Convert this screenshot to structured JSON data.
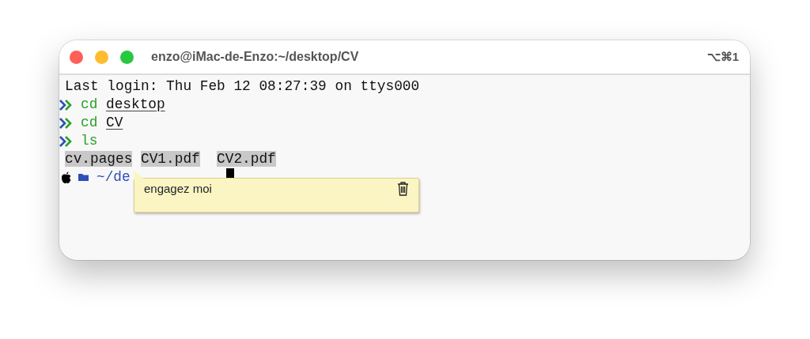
{
  "window": {
    "title": "enzo@iMac-de-Enzo:~/desktop/CV",
    "shortcut": "⌥⌘1"
  },
  "terminal": {
    "login": "Last login: Thu Feb 12 08:27:39 on ttys000",
    "commands": [
      {
        "command": "cd",
        "argument": "desktop"
      },
      {
        "command": "cd",
        "argument": "CV"
      },
      {
        "command": "ls"
      }
    ],
    "files": [
      {
        "name": "cv.pages",
        "highlighted": true
      },
      {
        "name": "CV1.pdf",
        "highlighted": true
      },
      {
        "name": "CV2.pdf",
        "highlighted": true
      }
    ],
    "prompt": {
      "path": "~/de"
    }
  },
  "note": {
    "text": "engagez moi"
  }
}
